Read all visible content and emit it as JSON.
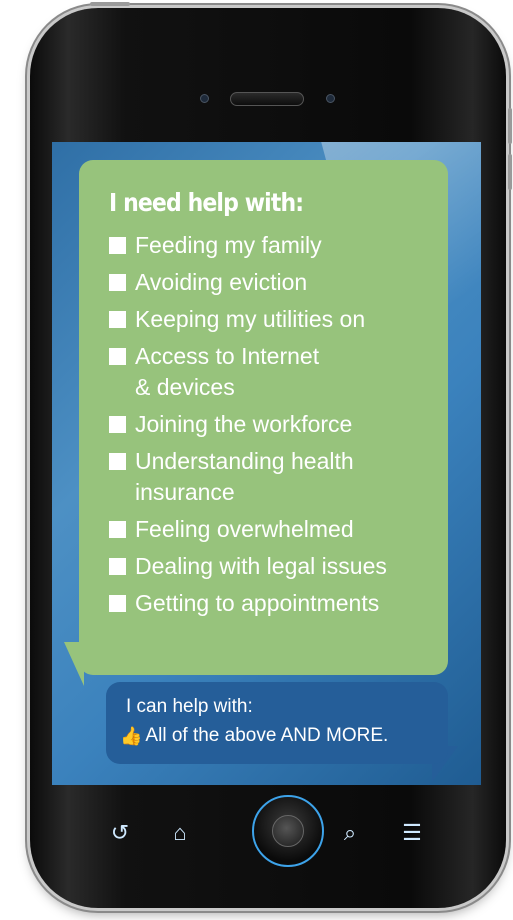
{
  "message": {
    "heading": "I need help with:",
    "items": [
      "Feeding my family",
      "Avoiding eviction",
      "Keeping my utilities on",
      "Access to Internet\n& devices",
      "Joining the workforce",
      "Understanding health\ninsurance",
      "Feeling overwhelmed",
      "Dealing with legal issues",
      "Getting to appointments"
    ]
  },
  "reply": {
    "line1": "I can help with:",
    "line2": "All of the above AND MORE."
  },
  "icons": {
    "reply": "thumbs-up-icon",
    "nav": [
      "refresh-icon",
      "home-icon",
      "search-icon",
      "list-icon"
    ]
  },
  "colors": {
    "green_bubble": "#97c37c",
    "blue_bubble": "#255e99",
    "screen": "#3b82bd"
  }
}
